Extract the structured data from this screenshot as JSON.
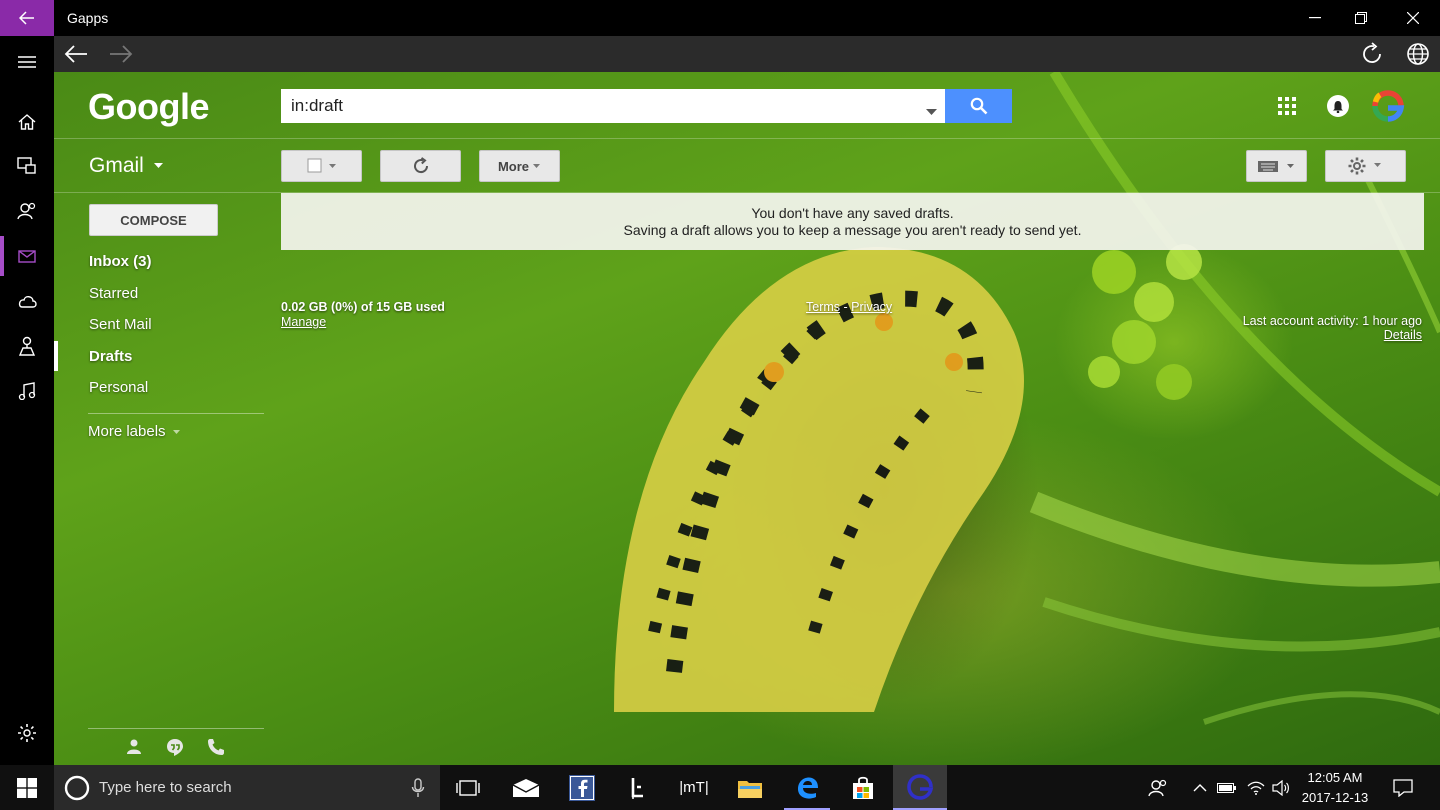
{
  "window": {
    "title": "Gapps",
    "icons": {
      "back": "back-arrow-icon",
      "minimize": "minimize-icon",
      "restore": "restore-icon",
      "close": "close-icon"
    }
  },
  "rail": {
    "items": [
      "menu-icon",
      "home-icon",
      "media-icon",
      "people-icon",
      "mail-icon",
      "cloud-icon",
      "maps-icon",
      "music-icon",
      "settings-icon"
    ],
    "active": "mail-icon",
    "accent_color": "#a64dc8"
  },
  "browser_nav": {
    "icons": [
      "back-icon",
      "forward-icon",
      "reload-icon",
      "globe-icon"
    ]
  },
  "header": {
    "logo": "Google",
    "search": {
      "value": "in:draft"
    },
    "icons": [
      "apps-icon",
      "notifications-icon",
      "google-account-icon"
    ]
  },
  "toolbar": {
    "app_label": "Gmail",
    "more_label": "More",
    "icons": [
      "select-checkbox-icon",
      "refresh-icon",
      "keyboard-icon",
      "settings-gear-icon"
    ]
  },
  "sidebar": {
    "compose_label": "COMPOSE",
    "items": [
      {
        "label": "Inbox (3)",
        "bold": true
      },
      {
        "label": "Starred",
        "bold": false
      },
      {
        "label": "Sent Mail",
        "bold": false
      },
      {
        "label": "Drafts",
        "bold": true,
        "selected": true
      },
      {
        "label": "Personal",
        "bold": false
      }
    ],
    "more_labels": "More labels"
  },
  "notice": {
    "line1": "You don't have any saved drafts.",
    "line2": "Saving a draft allows you to keep a message you aren't ready to send yet."
  },
  "footer": {
    "storage": "0.02 GB (0%) of 15 GB used",
    "manage": "Manage",
    "terms": "Terms",
    "separator": "-",
    "privacy": "Privacy",
    "activity": "Last account activity: 1 hour ago",
    "details": "Details"
  },
  "hangouts": {
    "icons": [
      "contacts-icon",
      "hangouts-icon",
      "phone-icon"
    ]
  },
  "taskbar": {
    "search_placeholder": "Type here to search",
    "apps": [
      "task-view-icon",
      "mail-app-icon",
      "facebook-icon",
      "tool-app-icon",
      "mt-app-icon",
      "file-explorer-icon",
      "edge-icon",
      "store-icon",
      "gapps-icon"
    ],
    "tray_icons": [
      "people-icon",
      "chevron-up-icon",
      "battery-icon",
      "wifi-icon",
      "volume-icon",
      "notifications-icon"
    ],
    "time": "12:05 AM",
    "date": "2017-12-13",
    "mt_label": "|mT|"
  }
}
